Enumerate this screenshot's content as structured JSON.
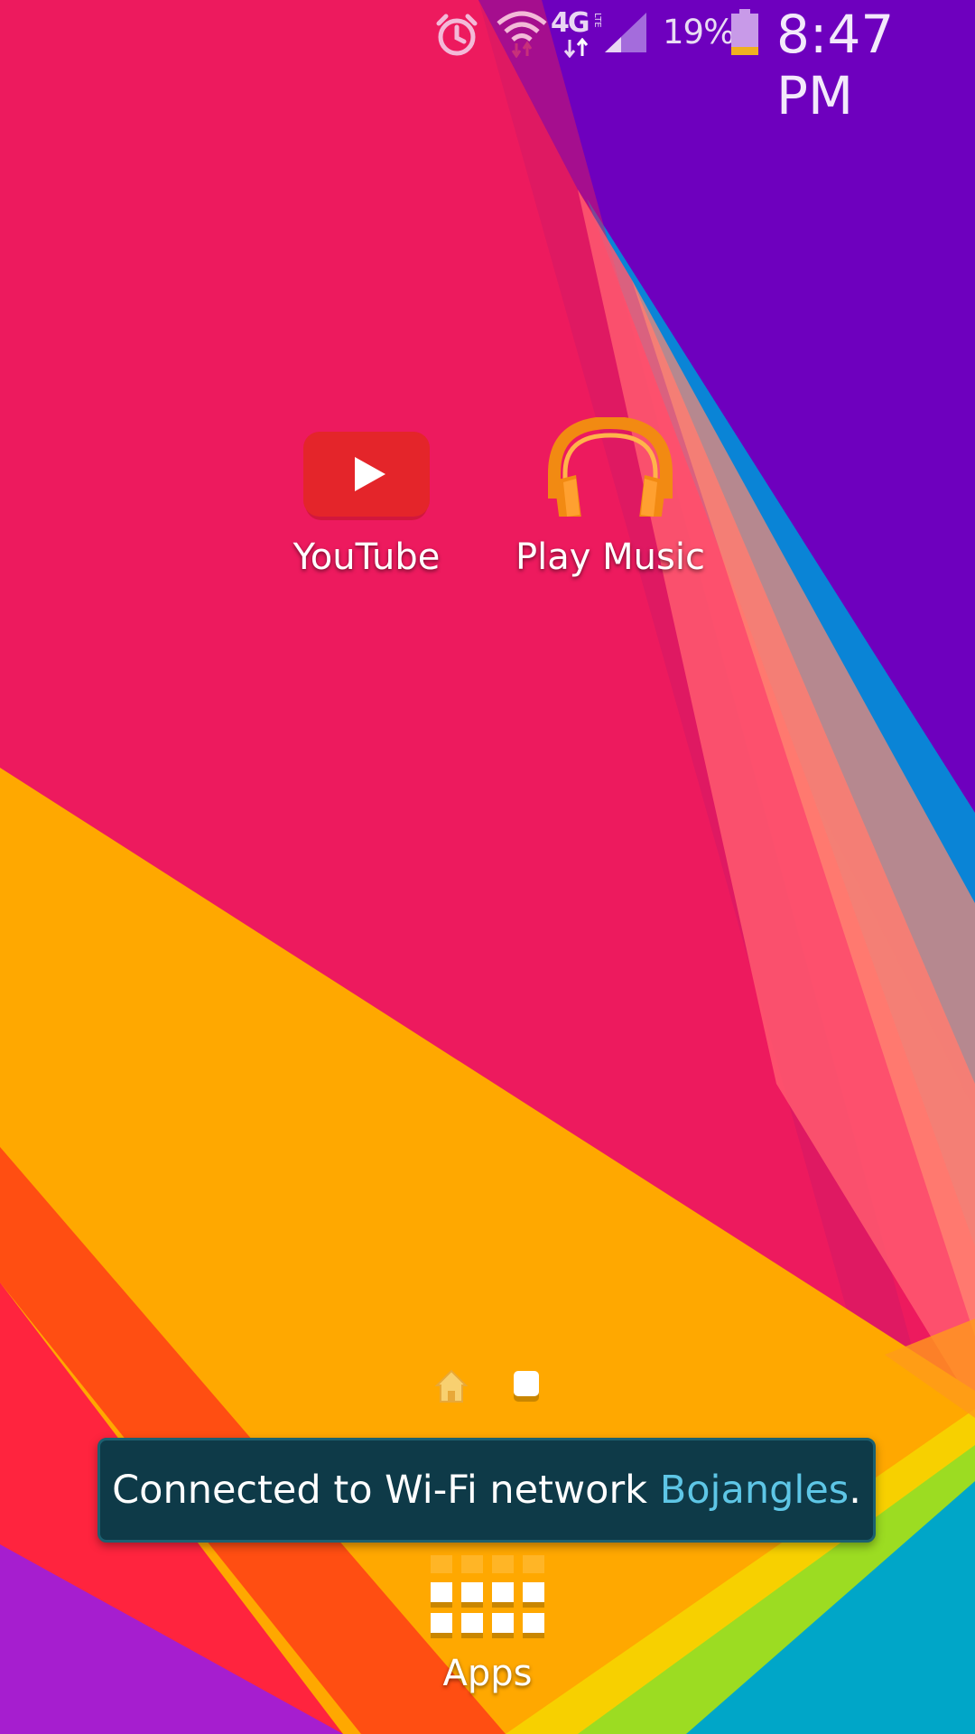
{
  "status_bar": {
    "icons": [
      "alarm-icon",
      "wifi-icon",
      "4g-lte-icon",
      "signal-icon",
      "battery-icon"
    ],
    "network_label": "4G",
    "network_sub_label": "LTE",
    "battery_percent": "19%",
    "battery_level": 0.19,
    "time": "8:47 PM"
  },
  "home": {
    "apps": [
      {
        "label": "YouTube",
        "icon": "youtube-icon"
      },
      {
        "label": "Play Music",
        "icon": "headphones-icon"
      }
    ],
    "page_indicators": [
      "home-page-icon",
      "page-dot"
    ]
  },
  "toast": {
    "prefix": "Connected to Wi-Fi network ",
    "network_name": "Bojangles",
    "suffix": "."
  },
  "dock": {
    "apps_label": "Apps",
    "apps_icon": "apps-grid-icon"
  },
  "colors": {
    "background_pink": "#ed1a5e",
    "purple": "#6e00be",
    "blue": "#0082d6",
    "orange": "#ffa800",
    "toast_bg": "#0e3a48",
    "toast_accent": "#5ec6e6"
  }
}
